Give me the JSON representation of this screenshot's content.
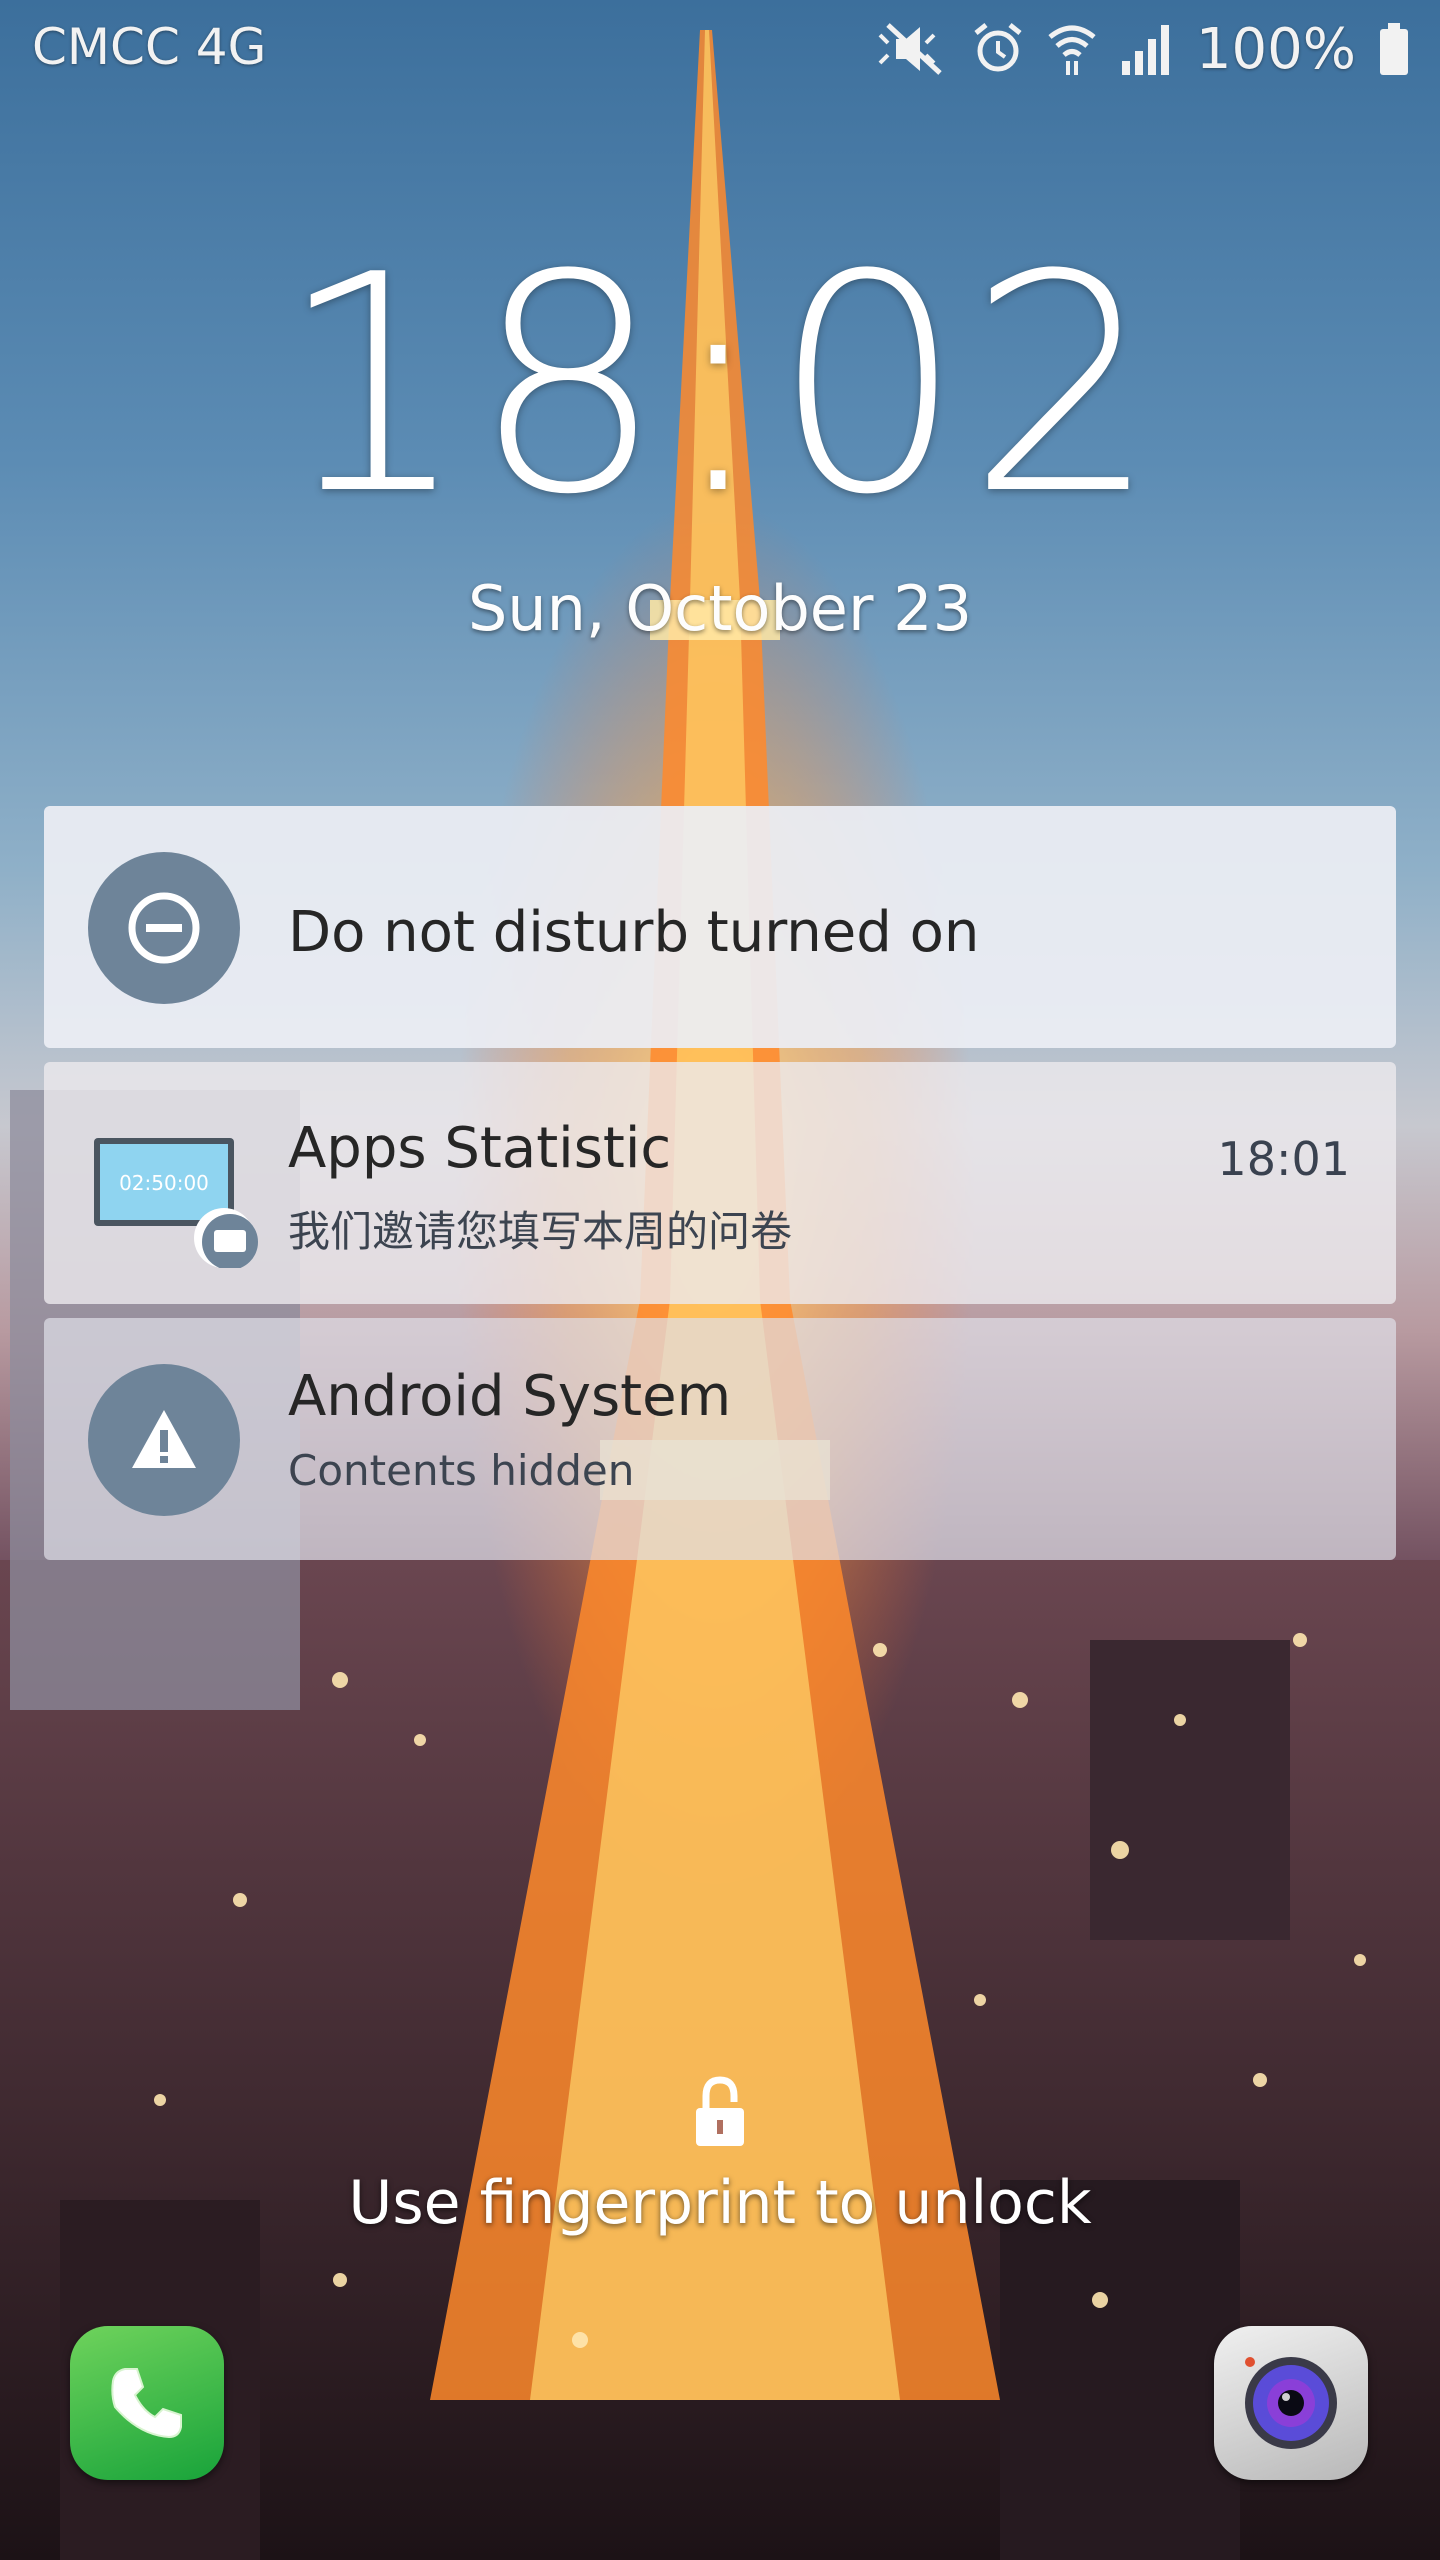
{
  "status_bar": {
    "carrier": "CMCC 4G",
    "battery_percent": "100%",
    "icons": [
      "mute-icon",
      "alarm-icon",
      "wifi-icon",
      "signal-icon",
      "battery-icon"
    ]
  },
  "clock": {
    "time": "18:02",
    "date": "Sun, October 23"
  },
  "notifications": [
    {
      "title": "Do not disturb turned on",
      "icon": "do-not-disturb-icon"
    },
    {
      "title": "Apps Statistic",
      "subtitle": "我们邀请您填写本周的问卷",
      "time": "18:01",
      "icon": "apps-statistic-icon",
      "icon_text": "02:50:00"
    },
    {
      "title": "Android System",
      "subtitle": "Contents hidden",
      "icon": "warning-icon"
    }
  ],
  "lockscreen": {
    "unlock_hint": "Use fingerprint to unlock",
    "shortcuts": [
      "phone-icon",
      "camera-icon"
    ]
  },
  "colors": {
    "notif_icon_bg": "#6e8499",
    "phone_green": "#18a33a"
  }
}
